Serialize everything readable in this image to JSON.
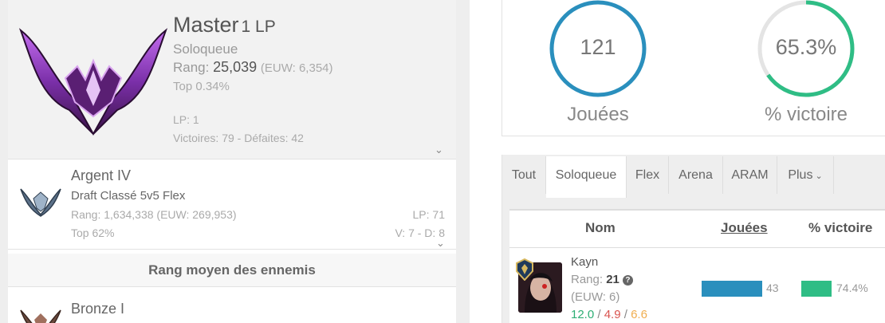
{
  "ranked_solo": {
    "tier": "Master",
    "lp_label": "1 LP",
    "queue": "Soloqueue",
    "rank_label": "Rang:",
    "rank_value": "25,039",
    "rank_euw": "(EUW: 6,354)",
    "top": "Top 0.34%",
    "lp": "LP: 1",
    "wins_losses": "Victoires: 79 - Défaites: 42"
  },
  "ranked_flex": {
    "tier": "Argent IV",
    "queue": "Draft Classé 5v5 Flex",
    "rank": "Rang: 1,634,338 (EUW: 269,953)",
    "top": "Top 62%",
    "lp": "LP: 71",
    "wins_losses": "V: 7 - D: 8"
  },
  "enemies": {
    "header": "Rang moyen des ennemis",
    "tier": "Bronze I"
  },
  "stats": {
    "games_value": "121",
    "games_label": "Jouées",
    "games_color": "#2a8fbd",
    "winrate_value": "65.3%",
    "winrate_fraction": 0.653,
    "winrate_label": "% victoire",
    "winrate_color": "#2fbd85"
  },
  "tabs": [
    {
      "label": "Tout",
      "active": false
    },
    {
      "label": "Soloqueue",
      "active": true
    },
    {
      "label": "Flex",
      "active": false
    },
    {
      "label": "Arena",
      "active": false
    },
    {
      "label": "ARAM",
      "active": false
    },
    {
      "label": "Plus",
      "active": false,
      "icon": "chevron-down-icon"
    }
  ],
  "table": {
    "headers": {
      "name": "Nom",
      "games": "Jouées",
      "winrate": "% victoire"
    },
    "rows": [
      {
        "champion": "Kayn",
        "rank_label": "Rang:",
        "rank_value": "21",
        "euw": "(EUW: 6)",
        "kills": "12.0",
        "deaths": "4.9",
        "assists": "6.6",
        "games": "43",
        "winrate": "74.4%"
      }
    ]
  }
}
